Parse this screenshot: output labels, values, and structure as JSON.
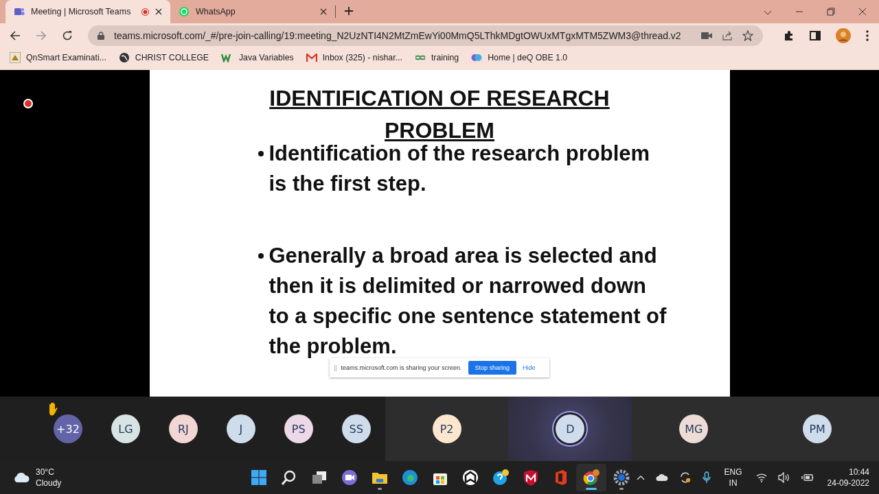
{
  "browser": {
    "tabs": [
      {
        "title": "Meeting | Microsoft Teams",
        "selected": true,
        "recording": true
      },
      {
        "title": "WhatsApp",
        "selected": false,
        "recording": false
      }
    ],
    "url": "teams.microsoft.com/_#/pre-join-calling/19:meeting_N2UzNTI4N2MtZmEwYi00MmQ5LThkMDgtOWUxMTgxMTM5ZWM3@thread.v2",
    "bookmarks": [
      "QnSmart Examinati...",
      "CHRIST COLLEGE",
      "Java Variables",
      "Inbox (325) - nishar...",
      "training",
      "Home | deQ OBE 1.0"
    ]
  },
  "slide": {
    "title": "IDENTIFICATION OF RESEARCH PROBLEM",
    "bullets": [
      "Identification of the research problem is the first step.",
      "Generally a broad area is selected and then it is delimited or narrowed down to a specific one sentence statement  of the problem."
    ]
  },
  "share_bar": {
    "message": "teams.microsoft.com is sharing your screen.",
    "stop_button": "Stop sharing",
    "hide_link": "Hide"
  },
  "participants": [
    {
      "initials": "+32",
      "color": "#6264a7",
      "hand_raised": true,
      "tile": false,
      "speaking": false
    },
    {
      "initials": "LG",
      "color": "#d8e4e4",
      "hand_raised": false,
      "tile": false,
      "speaking": false
    },
    {
      "initials": "RJ",
      "color": "#f2d6d3",
      "hand_raised": false,
      "tile": false,
      "speaking": false
    },
    {
      "initials": "J",
      "color": "#cfdcec",
      "hand_raised": false,
      "tile": false,
      "speaking": false
    },
    {
      "initials": "PS",
      "color": "#ecd8e6",
      "hand_raised": false,
      "tile": false,
      "speaking": false
    },
    {
      "initials": "SS",
      "color": "#cfdcec",
      "hand_raised": false,
      "tile": false,
      "speaking": false
    },
    {
      "initials": "P2",
      "color": "#fce6cf",
      "hand_raised": false,
      "tile": true,
      "speaking": false
    },
    {
      "initials": "D",
      "color": "#cfdcec",
      "hand_raised": false,
      "tile": true,
      "speaking": true
    },
    {
      "initials": "MG",
      "color": "#ecdcd5",
      "hand_raised": false,
      "tile": true,
      "speaking": false
    },
    {
      "initials": "PM",
      "color": "#cfdcec",
      "hand_raised": false,
      "tile": true,
      "speaking": false
    }
  ],
  "taskbar": {
    "weather": {
      "temperature": "30°C",
      "condition": "Cloudy"
    },
    "apps": [
      {
        "running": false,
        "active": false
      },
      {
        "running": false,
        "active": false
      },
      {
        "running": false,
        "active": false
      },
      {
        "running": false,
        "active": false
      },
      {
        "running": true,
        "active": false
      },
      {
        "running": false,
        "active": false
      },
      {
        "running": false,
        "active": false
      },
      {
        "running": false,
        "active": false
      },
      {
        "running": false,
        "active": false
      },
      {
        "running": false,
        "active": false
      },
      {
        "running": false,
        "active": false
      },
      {
        "running": true,
        "active": true
      },
      {
        "running": true,
        "active": false
      }
    ],
    "language": "ENG",
    "region": "IN",
    "time": "10:44",
    "date": "24-09-2022"
  }
}
